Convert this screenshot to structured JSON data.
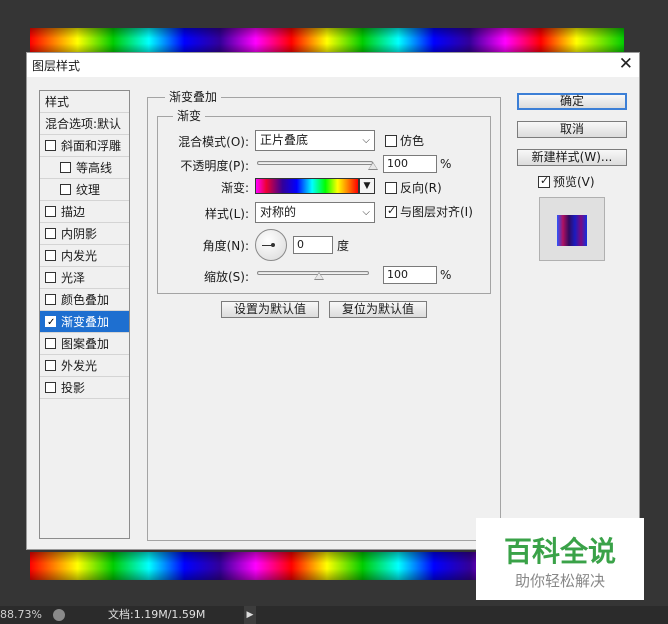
{
  "dialog": {
    "title": "图层样式"
  },
  "styles": {
    "header": "样式",
    "blend_options": "混合选项:默认",
    "items": [
      {
        "label": "斜面和浮雕",
        "checked": false
      },
      {
        "label": "等高线",
        "checked": false
      },
      {
        "label": "纹理",
        "checked": false
      },
      {
        "label": "描边",
        "checked": false
      },
      {
        "label": "内阴影",
        "checked": false
      },
      {
        "label": "内发光",
        "checked": false
      },
      {
        "label": "光泽",
        "checked": false
      },
      {
        "label": "颜色叠加",
        "checked": false
      },
      {
        "label": "渐变叠加",
        "checked": true
      },
      {
        "label": "图案叠加",
        "checked": false
      },
      {
        "label": "外发光",
        "checked": false
      },
      {
        "label": "投影",
        "checked": false
      }
    ]
  },
  "panel": {
    "title": "渐变叠加",
    "group": "渐变",
    "blend_mode_label": "混合模式(O):",
    "blend_mode_value": "正片叠底",
    "dither_label": "仿色",
    "dither_checked": false,
    "opacity_label": "不透明度(P):",
    "opacity_value": "100",
    "opacity_unit": "%",
    "opacity_level": 1.0,
    "gradient_label": "渐变:",
    "reverse_label": "反向(R)",
    "reverse_checked": false,
    "style_label": "样式(L):",
    "style_value": "对称的",
    "align_label": "与图层对齐(I)",
    "align_checked": true,
    "angle_label": "角度(N):",
    "angle_value": "0",
    "angle_unit": "度",
    "scale_label": "缩放(S):",
    "scale_value": "100",
    "scale_unit": "%",
    "scale_level": 0.5,
    "set_default": "设置为默认值",
    "reset_default": "复位为默认值"
  },
  "buttons": {
    "ok": "确定",
    "cancel": "取消",
    "new_style": "新建样式(W)...",
    "preview_label": "预览(V)",
    "preview_checked": true
  },
  "status": {
    "zoom": "88.73%",
    "doc": "文档:1.19M/1.59M"
  },
  "watermark": {
    "line1": "百科全说",
    "line2": "助你轻松解决"
  }
}
